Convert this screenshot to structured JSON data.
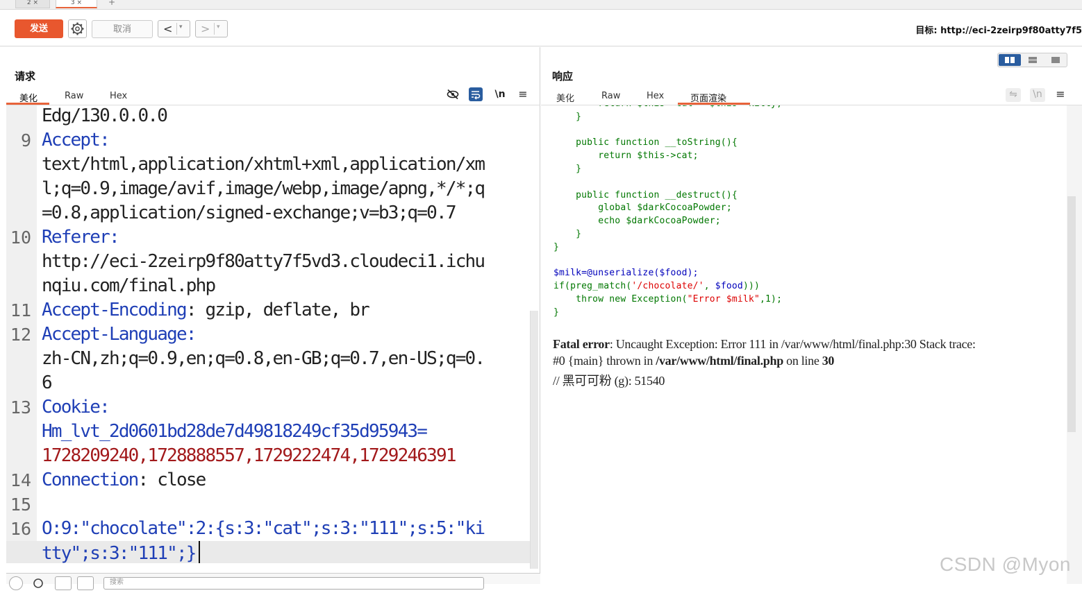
{
  "tabs": {
    "tab_a": "2 ×",
    "tab_b": "3 ×",
    "tab_add": "+"
  },
  "toolbar": {
    "send_label": "发送",
    "cancel_label": "取消",
    "prev_label": "<",
    "next_label": ">",
    "dropdown_caret": "▾",
    "target_text": "目标: http://eci-2zeirp9f80atty7f5"
  },
  "request": {
    "title": "请求",
    "tabs": [
      "美化",
      "Raw",
      "Hex"
    ],
    "icons": [
      "eye-off-icon",
      "wrap-icon",
      "newline-icon",
      "menu-icon"
    ],
    "newline_label": "\\n",
    "menu_label": "≡",
    "lines": [
      {
        "num": "",
        "text": "Edg/130.0.0.0"
      },
      {
        "num": "9",
        "text": "Accept:"
      },
      {
        "num": "",
        "text": "text/html,application/xhtml+xml,application/xm"
      },
      {
        "num": "",
        "text": "l;q=0.9,image/avif,image/webp,image/apng,*/*;q"
      },
      {
        "num": "",
        "text": "=0.8,application/signed-exchange;v=b3;q=0.7"
      },
      {
        "num": "10",
        "text": "Referer:"
      },
      {
        "num": "",
        "text": "http://eci-2zeirp9f80atty7f5vd3.cloudeci1.ichu"
      },
      {
        "num": "",
        "text": "nqiu.com/final.php"
      },
      {
        "num": "11",
        "key": "Accept-Encoding",
        "text": ": gzip, deflate, br"
      },
      {
        "num": "12",
        "text": "Accept-Language:"
      },
      {
        "num": "",
        "text": "zh-CN,zh;q=0.9,en;q=0.8,en-GB;q=0.7,en-US;q=0."
      },
      {
        "num": "",
        "text": "6"
      },
      {
        "num": "13",
        "text": "Cookie:"
      },
      {
        "num": "",
        "key": "Hm_lvt_2d0601bd28de7d49818249cf35d95943",
        "text": "="
      },
      {
        "num": "",
        "text": "1728209240,1728888557,1729222474,1729246391"
      },
      {
        "num": "14",
        "key": "Connection",
        "text": ": close"
      },
      {
        "num": "15",
        "text": ""
      },
      {
        "num": "16",
        "text": "O:9:\"chocolate\":2:{s:3:\"cat\";s:3:\"111\";s:5:\"ki"
      },
      {
        "num": "",
        "text": "tty\";s:3:\"111\";}"
      }
    ],
    "search_placeholder": "搜索"
  },
  "response": {
    "title": "响应",
    "tabs": [
      "美化",
      "Raw",
      "Hex",
      "页面渲染"
    ],
    "wrap_label": "⇋",
    "newline_label": "\\n",
    "menu_label": "≡",
    "code_lines": [
      "        return $this->cat===$this->kitty;",
      "    }",
      "",
      "    public function __toString(){",
      "        return $this->cat;",
      "    }",
      "",
      "    public function __destruct(){",
      "        global $darkCocoaPowder;",
      "        echo $darkCocoaPowder;",
      "    }",
      "}",
      "",
      "$milk=@unserialize($food);",
      "if(preg_match('/chocolate/', $food)){",
      "    throw new Exception(\"Error $milk\",1);",
      "}"
    ],
    "fatal": {
      "label": "Fatal error",
      "message": ": Uncaught Exception: Error 111 in /var/www/html/final.php:30 Stack trace:",
      "line2_prefix": "#0 {main} thrown in ",
      "file": "/var/www/html/final.php",
      "on_line": " on line ",
      "line_no": "30",
      "comment": "// 黑可可粉 (g): 51540"
    }
  },
  "watermark": "CSDN @Myon",
  "colors": {
    "accent": "#e8572e",
    "header_blue": "#1f3fb6",
    "cookie_red": "#a2191b",
    "php_green": "#007700",
    "php_blue": "#0000bb",
    "php_red": "#dd0000",
    "toggle_blue": "#2a5d9f"
  }
}
